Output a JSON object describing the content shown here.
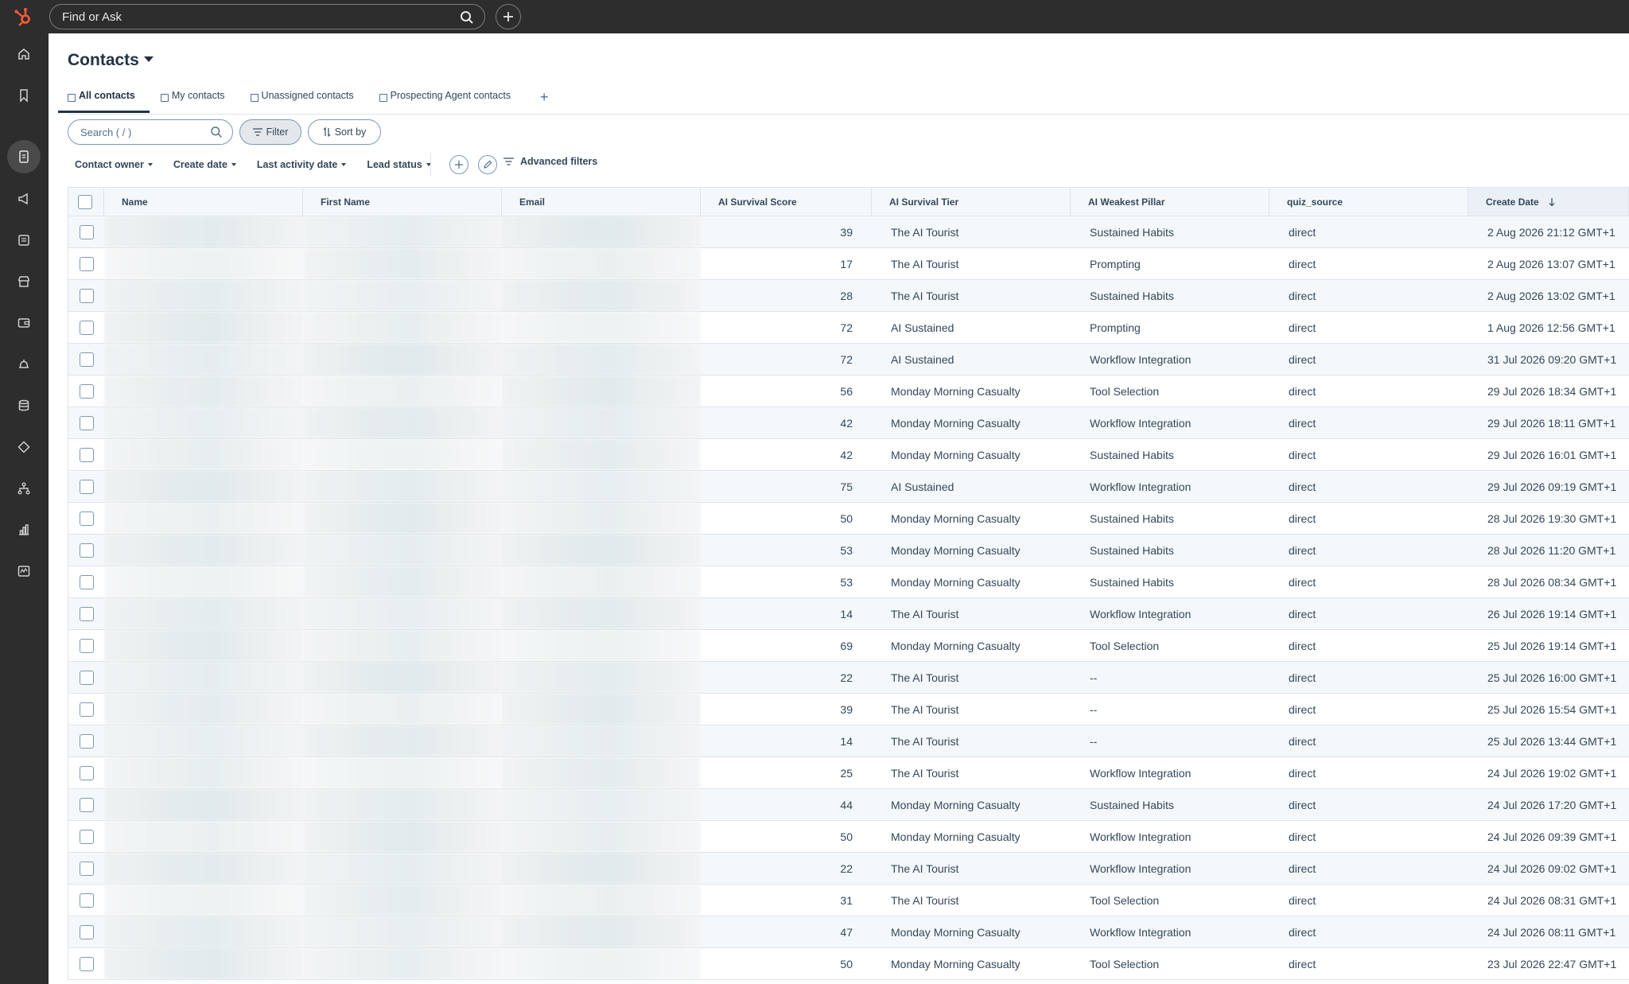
{
  "topbar": {
    "search_placeholder": "Find or Ask"
  },
  "page": {
    "title": "Contacts"
  },
  "tabs": [
    {
      "label": "All contacts",
      "active": true
    },
    {
      "label": "My contacts"
    },
    {
      "label": "Unassigned contacts"
    },
    {
      "label": "Prospecting Agent contacts"
    }
  ],
  "toolbar": {
    "search_placeholder": "Search ( / )",
    "filter_label": "Filter",
    "sort_label": "Sort by"
  },
  "quick_filters": [
    "Contact owner",
    "Create date",
    "Last activity date",
    "Lead status"
  ],
  "advanced_filters_label": "Advanced filters",
  "columns": [
    "Name",
    "First Name",
    "Email",
    "AI Survival Score",
    "AI Survival Tier",
    "AI Weakest Pillar",
    "quiz_source",
    "Create Date"
  ],
  "rows": [
    {
      "score": "39",
      "tier": "The AI Tourist",
      "pillar": "Sustained Habits",
      "source": "direct",
      "date": "2 Aug 2026 21:12 GMT+1"
    },
    {
      "score": "17",
      "tier": "The AI Tourist",
      "pillar": "Prompting",
      "source": "direct",
      "date": "2 Aug 2026 13:07 GMT+1"
    },
    {
      "score": "28",
      "tier": "The AI Tourist",
      "pillar": "Sustained Habits",
      "source": "direct",
      "date": "2 Aug 2026 13:02 GMT+1"
    },
    {
      "score": "72",
      "tier": "AI Sustained",
      "pillar": "Prompting",
      "source": "direct",
      "date": "1 Aug 2026 12:56 GMT+1"
    },
    {
      "score": "72",
      "tier": "AI Sustained",
      "pillar": "Workflow Integration",
      "source": "direct",
      "date": "31 Jul 2026 09:20 GMT+1"
    },
    {
      "score": "56",
      "tier": "Monday Morning Casualty",
      "pillar": "Tool Selection",
      "source": "direct",
      "date": "29 Jul 2026 18:34 GMT+1"
    },
    {
      "score": "42",
      "tier": "Monday Morning Casualty",
      "pillar": "Workflow Integration",
      "source": "direct",
      "date": "29 Jul 2026 18:11 GMT+1"
    },
    {
      "score": "42",
      "tier": "Monday Morning Casualty",
      "pillar": "Sustained Habits",
      "source": "direct",
      "date": "29 Jul 2026 16:01 GMT+1"
    },
    {
      "score": "75",
      "tier": "AI Sustained",
      "pillar": "Workflow Integration",
      "source": "direct",
      "date": "29 Jul 2026 09:19 GMT+1"
    },
    {
      "score": "50",
      "tier": "Monday Morning Casualty",
      "pillar": "Sustained Habits",
      "source": "direct",
      "date": "28 Jul 2026 19:30 GMT+1"
    },
    {
      "score": "53",
      "tier": "Monday Morning Casualty",
      "pillar": "Sustained Habits",
      "source": "direct",
      "date": "28 Jul 2026 11:20 GMT+1"
    },
    {
      "score": "53",
      "tier": "Monday Morning Casualty",
      "pillar": "Sustained Habits",
      "source": "direct",
      "date": "28 Jul 2026 08:34 GMT+1"
    },
    {
      "score": "14",
      "tier": "The AI Tourist",
      "pillar": "Workflow Integration",
      "source": "direct",
      "date": "26 Jul 2026 19:14 GMT+1"
    },
    {
      "score": "69",
      "tier": "Monday Morning Casualty",
      "pillar": "Tool Selection",
      "source": "direct",
      "date": "25 Jul 2026 19:14 GMT+1"
    },
    {
      "score": "22",
      "tier": "The AI Tourist",
      "pillar": "--",
      "source": "direct",
      "date": "25 Jul 2026 16:00 GMT+1"
    },
    {
      "score": "39",
      "tier": "The AI Tourist",
      "pillar": "--",
      "source": "direct",
      "date": "25 Jul 2026 15:54 GMT+1"
    },
    {
      "score": "14",
      "tier": "The AI Tourist",
      "pillar": "--",
      "source": "direct",
      "date": "25 Jul 2026 13:44 GMT+1"
    },
    {
      "score": "25",
      "tier": "The AI Tourist",
      "pillar": "Workflow Integration",
      "source": "direct",
      "date": "24 Jul 2026 19:02 GMT+1"
    },
    {
      "score": "44",
      "tier": "Monday Morning Casualty",
      "pillar": "Sustained Habits",
      "source": "direct",
      "date": "24 Jul 2026 17:20 GMT+1"
    },
    {
      "score": "50",
      "tier": "Monday Morning Casualty",
      "pillar": "Workflow Integration",
      "source": "direct",
      "date": "24 Jul 2026 09:39 GMT+1"
    },
    {
      "score": "22",
      "tier": "The AI Tourist",
      "pillar": "Workflow Integration",
      "source": "direct",
      "date": "24 Jul 2026 09:02 GMT+1"
    },
    {
      "score": "31",
      "tier": "The AI Tourist",
      "pillar": "Tool Selection",
      "source": "direct",
      "date": "24 Jul 2026 08:31 GMT+1"
    },
    {
      "score": "47",
      "tier": "Monday Morning Casualty",
      "pillar": "Workflow Integration",
      "source": "direct",
      "date": "24 Jul 2026 08:11 GMT+1"
    },
    {
      "score": "50",
      "tier": "Monday Morning Casualty",
      "pillar": "Tool Selection",
      "source": "direct",
      "date": "23 Jul 2026 22:47 GMT+1"
    }
  ]
}
